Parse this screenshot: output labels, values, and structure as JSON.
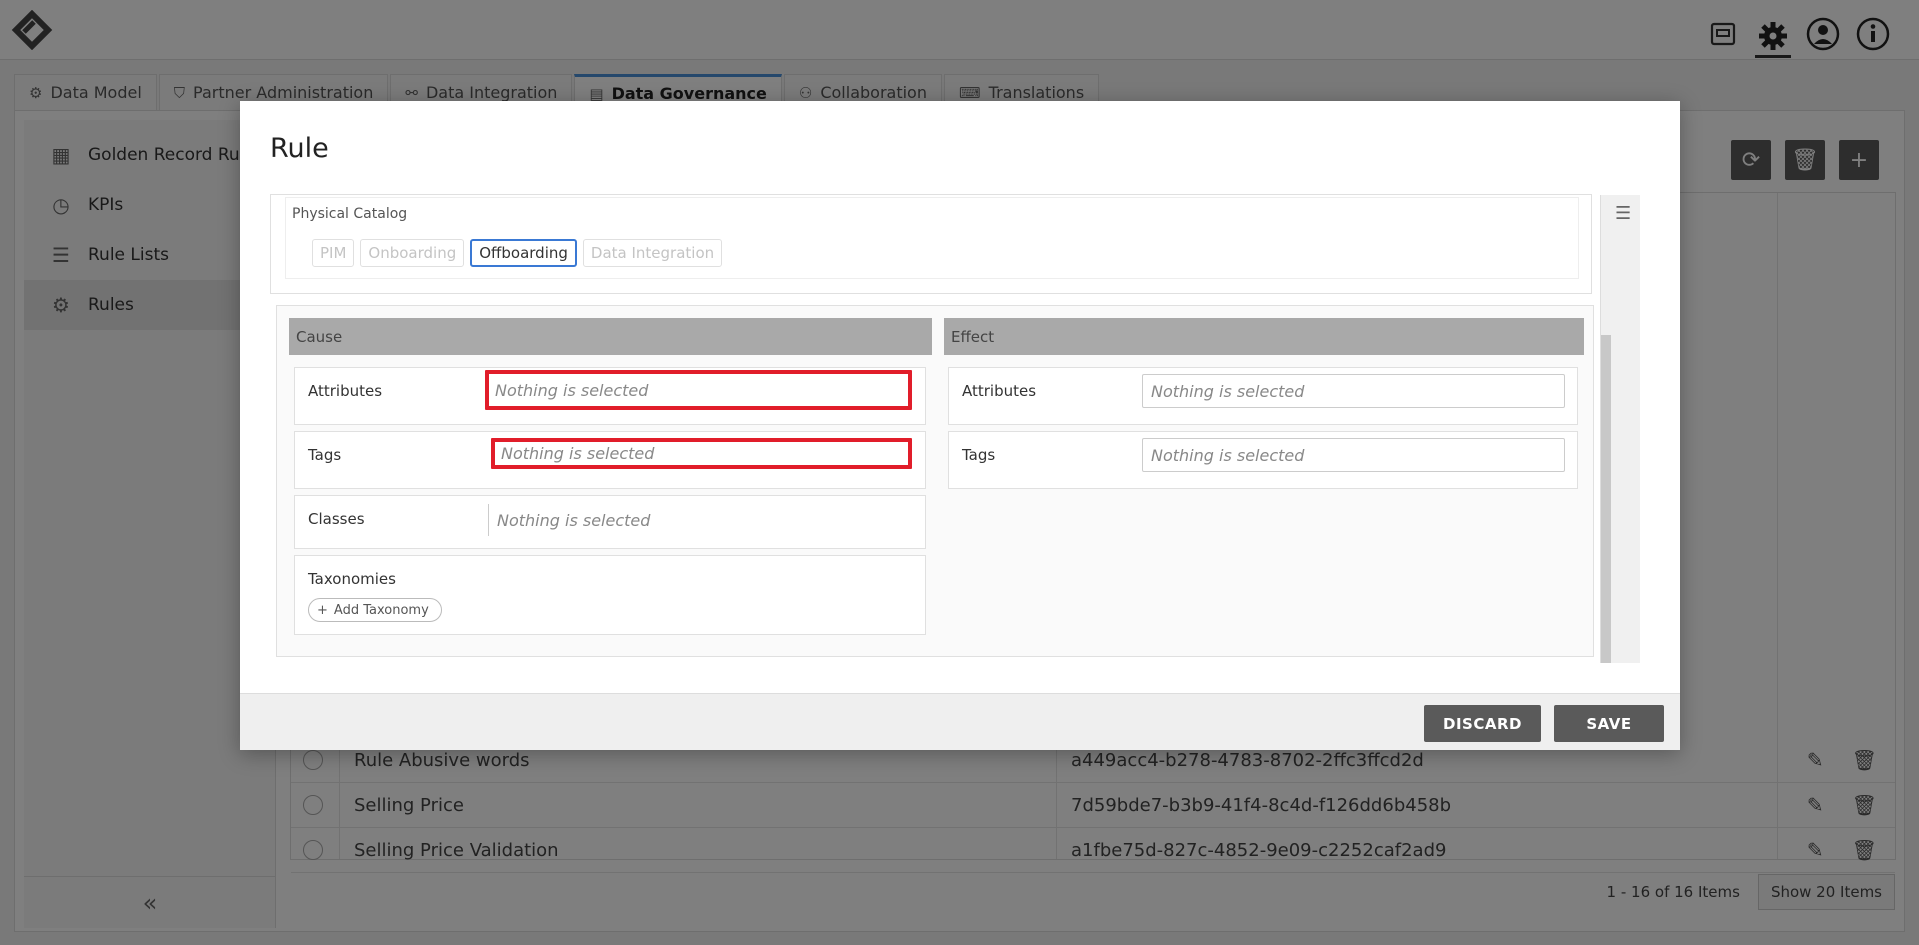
{
  "app": {
    "top_icons": [
      "inbox-icon",
      "gear-icon",
      "user-icon",
      "info-icon"
    ]
  },
  "tabs": [
    {
      "label": "Data Model",
      "icon": "model-icon"
    },
    {
      "label": "Partner Administration",
      "icon": "shield-icon"
    },
    {
      "label": "Data Integration",
      "icon": "network-icon"
    },
    {
      "label": "Data Governance",
      "icon": "governance-icon",
      "active": true
    },
    {
      "label": "Collaboration",
      "icon": "collaboration-icon"
    },
    {
      "label": "Translations",
      "icon": "translate-icon"
    }
  ],
  "sidebar": {
    "items": [
      {
        "label": "Golden Record Rules",
        "icon": "golden-record-icon"
      },
      {
        "label": "KPIs",
        "icon": "gauge-icon"
      },
      {
        "label": "Rule Lists",
        "icon": "list-icon"
      },
      {
        "label": "Rules",
        "icon": "rules-gear-icon",
        "active": true
      }
    ],
    "collapse_glyph": "«"
  },
  "grid": {
    "visible_rows": [
      {
        "name": "Rule Abusive words",
        "id": "a449acc4-b278-4783-8702-2ffc3ffcd2d"
      },
      {
        "name": "Selling Price",
        "id": "7d59bde7-b3b9-41f4-8c4d-f126dd6b458b"
      },
      {
        "name": "Selling Price Validation",
        "id": "a1fbe75d-827c-4852-9e09-c2252caf2ad9"
      }
    ],
    "pager_text": "1 - 16 of 16 Items",
    "page_size_button": "Show 20 Items"
  },
  "modal": {
    "title": "Rule",
    "catalog": {
      "label": "Physical Catalog",
      "chips": [
        {
          "label": "PIM",
          "selected": false
        },
        {
          "label": "Onboarding",
          "selected": false
        },
        {
          "label": "Offboarding",
          "selected": true
        },
        {
          "label": "Data Integration",
          "selected": false
        }
      ]
    },
    "cause": {
      "heading": "Cause",
      "attributes_label": "Attributes",
      "attributes_value": "Nothing is selected",
      "tags_label": "Tags",
      "tags_value": "Nothing is selected",
      "classes_label": "Classes",
      "classes_value": "Nothing is selected",
      "taxonomies_label": "Taxonomies",
      "add_taxonomy": "Add Taxonomy"
    },
    "effect": {
      "heading": "Effect",
      "attributes_label": "Attributes",
      "attributes_value": "Nothing is selected",
      "tags_label": "Tags",
      "tags_value": "Nothing is selected"
    },
    "discard_label": "DISCARD",
    "save_label": "SAVE"
  },
  "colors": {
    "accent": "#3a79d4",
    "error": "#e11d2a",
    "button": "#5a5a5a",
    "section_head": "#a9a9a9"
  }
}
